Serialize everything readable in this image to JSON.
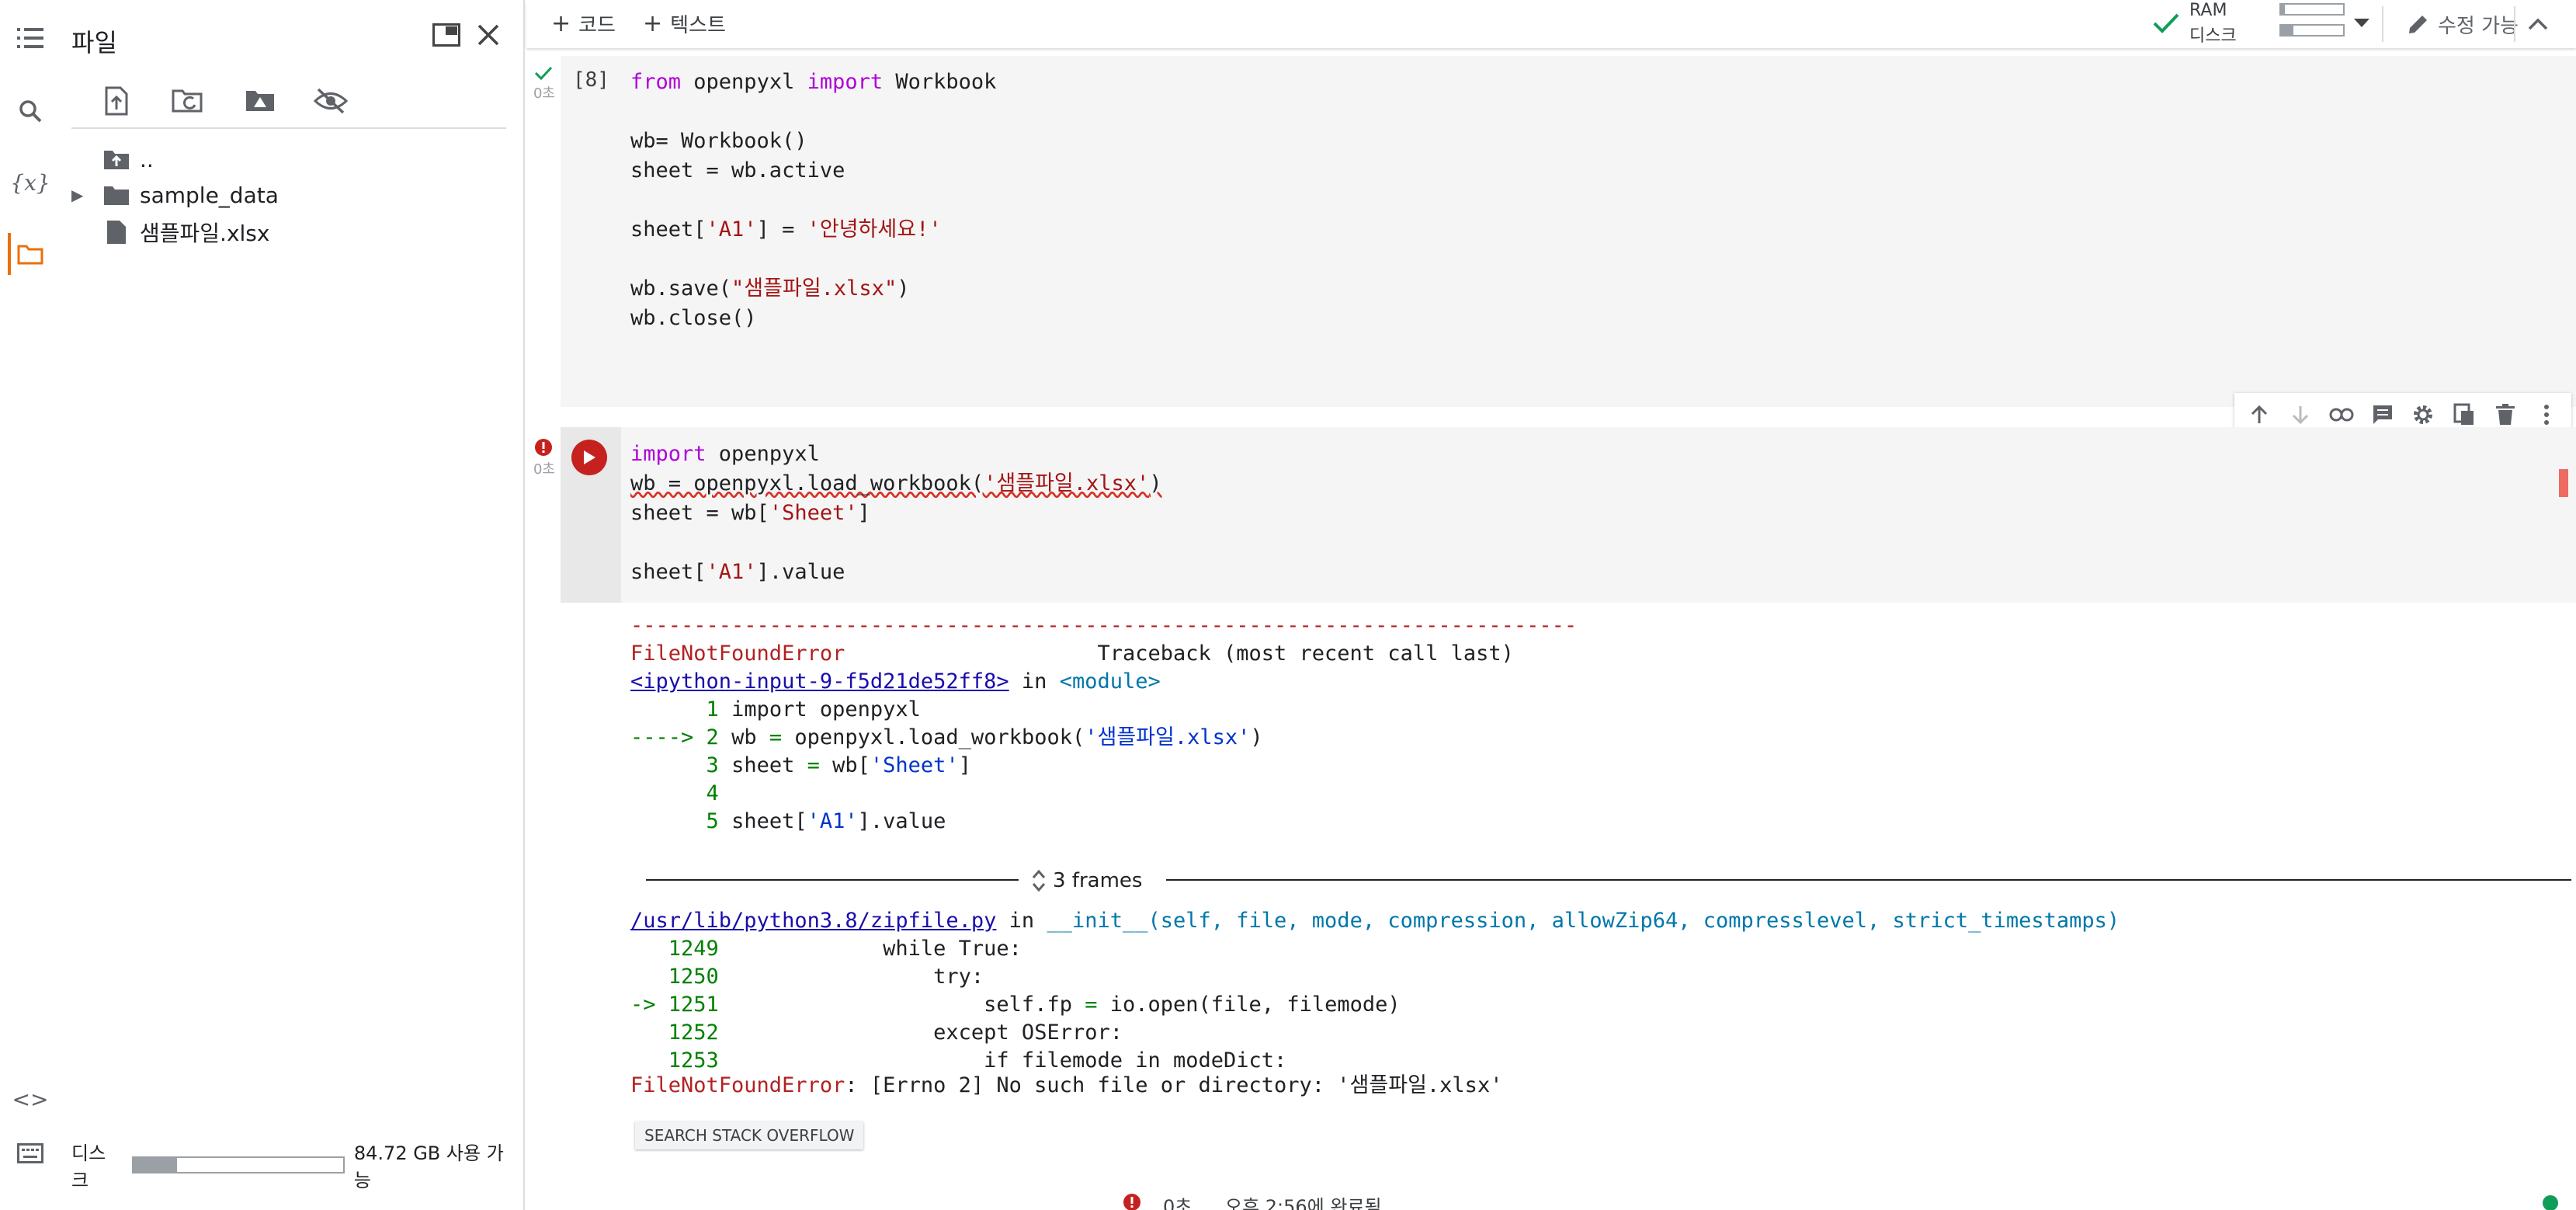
{
  "files_panel": {
    "title": "파일",
    "tree": [
      {
        "label": ".."
      },
      {
        "label": "sample_data"
      },
      {
        "label": "샘플파일.xlsx"
      }
    ],
    "disk_label": "디스크",
    "disk_available": "84.72 GB 사용 가능",
    "disk_used_fraction": 0.21
  },
  "toolbar": {
    "add_code": "코드",
    "add_text": "텍스트",
    "ram_label": "RAM",
    "disk_label": "디스크",
    "ram_used_fraction": 0.06,
    "disk_used_fraction": 0.2,
    "edit_mode": "수정 가능"
  },
  "cell1": {
    "exec_count": "[8]",
    "status": "0초",
    "lines": [
      [
        "from",
        " openpyxl ",
        "import",
        " Workbook"
      ],
      [],
      [
        "wb= Workbook()"
      ],
      [
        "sheet = wb.active"
      ],
      [],
      [
        "sheet[",
        "'A1'",
        "] = ",
        "'안녕하세요!'"
      ],
      [],
      [
        "wb.save(",
        "\"샘플파일.xlsx\"",
        ")"
      ],
      [
        "wb.close()"
      ]
    ]
  },
  "cell2": {
    "status": "0초",
    "l1a": "import",
    "l1b": " openpyxl",
    "l2a": "wb = openpyxl.load_workbook(",
    "l2b": "'샘플파일.xlsx'",
    "l2c": ")",
    "l3a": "sheet = wb[",
    "l3b": "'Sheet'",
    "l3c": "]",
    "l5a": "sheet[",
    "l5b": "'A1'",
    "l5c": "].value"
  },
  "output": {
    "dashes": "---------------------------------------------------------------------------",
    "err_name": "FileNotFoundError",
    "traceback_hdr": "Traceback (most recent call last)",
    "link1": "<ipython-input-9-f5d21de52ff8>",
    "in_word": " in ",
    "module": "<module>",
    "tb_lines": [
      {
        "arrow": "      ",
        "no": "1",
        "code": "import openpyxl"
      },
      {
        "arrow": "----> ",
        "no": "2",
        "code": "wb = openpyxl.load_workbook('샘플파일.xlsx')"
      },
      {
        "arrow": "      ",
        "no": "3",
        "code": "sheet = wb['Sheet']"
      },
      {
        "arrow": "      ",
        "no": "4",
        "code": ""
      },
      {
        "arrow": "      ",
        "no": "5",
        "code": "sheet['A1'].value"
      }
    ],
    "frames_label": "3 frames",
    "link2": "/usr/lib/python3.8/zipfile.py",
    "func": "__init__(self, file, mode, compression, allowZip64, compresslevel, strict_timestamps)",
    "zip_lines": [
      {
        "arrow": "   ",
        "no": "1249",
        "code": "            while True:"
      },
      {
        "arrow": "   ",
        "no": "1250",
        "code": "                try:"
      },
      {
        "arrow": "-> ",
        "no": "1251",
        "code": "                    self.fp = io.open(file, filemode)"
      },
      {
        "arrow": "   ",
        "no": "1252",
        "code": "                except OSError:"
      },
      {
        "arrow": "   ",
        "no": "1253",
        "code": "                    if filemode in modeDict:"
      }
    ],
    "final_err_name": "FileNotFoundError",
    "final_err_msg": ": [Errno 2] No such file or directory: '샘플파일.xlsx'",
    "so_button": "SEARCH STACK OVERFLOW"
  },
  "statusbar": {
    "elapsed": "0초",
    "completed": "오후 2:56에 완료됨"
  },
  "colors": {
    "accent": "#e8710a",
    "error": "#c5221f",
    "success": "#0f9d58"
  }
}
